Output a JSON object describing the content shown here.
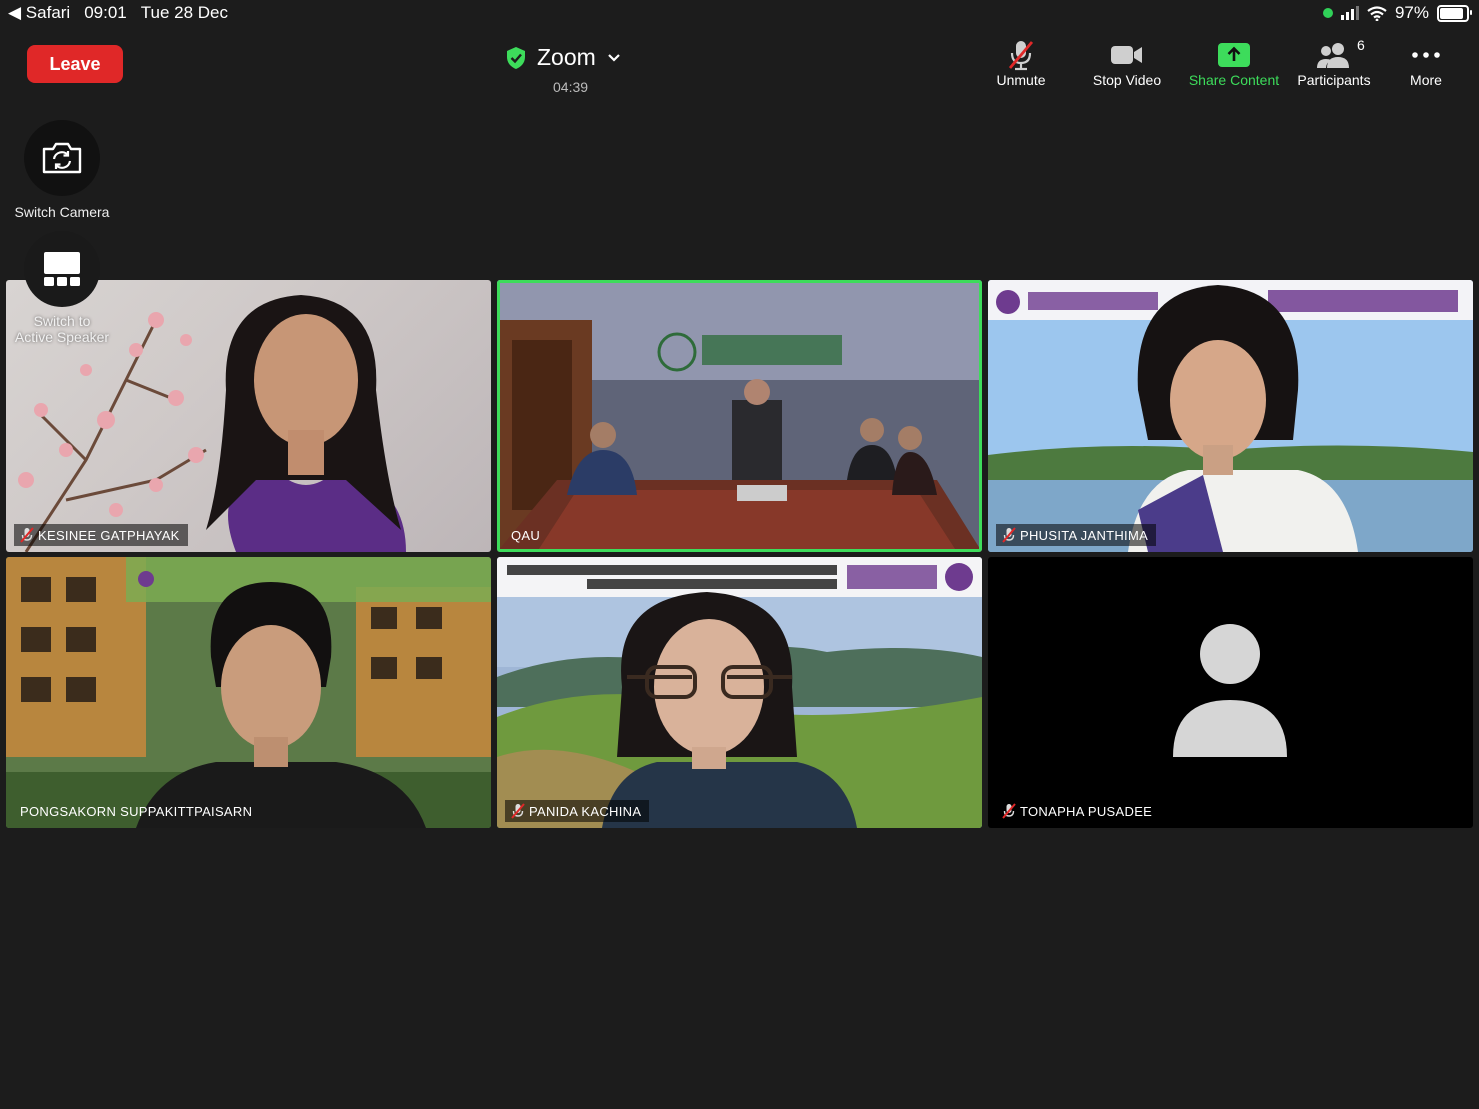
{
  "status_bar": {
    "back_app": "Safari",
    "time": "09:01",
    "date": "Tue 28 Dec",
    "battery": "97%",
    "battery_level": 0.97
  },
  "header": {
    "leave_label": "Leave",
    "meeting_title": "Zoom",
    "elapsed": "04:39"
  },
  "toolbar": {
    "unmute": "Unmute",
    "stop_video": "Stop Video",
    "share_content": "Share Content",
    "participants": "Participants",
    "participants_count": "6",
    "more": "More"
  },
  "side": {
    "switch_camera": "Switch Camera",
    "switch_speaker_line1": "Switch to",
    "switch_speaker_line2": "Active Speaker"
  },
  "tiles": [
    {
      "name": "KESINEE GATPHAYAK",
      "muted": true
    },
    {
      "name": "QAU",
      "muted": false,
      "active": true
    },
    {
      "name": "PHUSITA JANTHIMA",
      "muted": true
    },
    {
      "name": "PONGSAKORN SUPPAKITTPAISARN",
      "muted": false
    },
    {
      "name": "PANIDA KACHINA",
      "muted": true
    },
    {
      "name": "TONAPHA PUSADEE",
      "muted": true,
      "video_off": true
    }
  ],
  "colors": {
    "leave": "#e02828",
    "accent_green": "#3ddc5b",
    "background": "#1c1c1c"
  }
}
